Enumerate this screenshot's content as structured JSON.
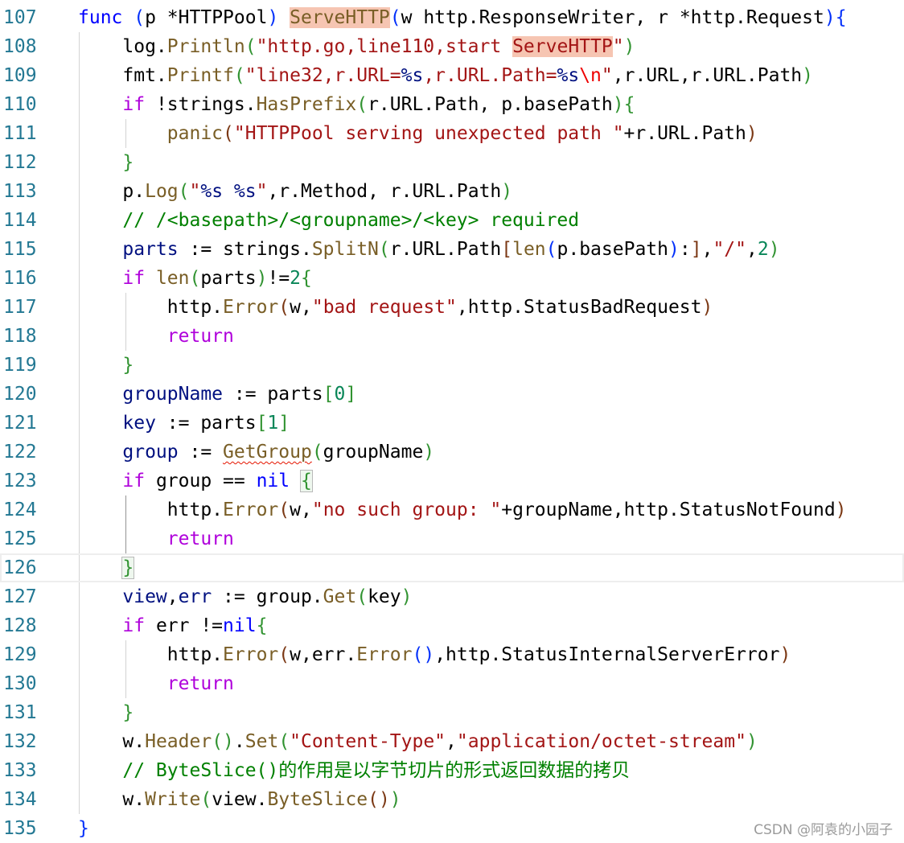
{
  "editor": {
    "current_line": "126",
    "lines": [
      {
        "number": "107",
        "indent": 0,
        "tokens": [
          {
            "t": "func",
            "c": "kw"
          },
          {
            "t": " "
          },
          {
            "t": "(",
            "c": "b1"
          },
          {
            "t": "p *HTTPPool"
          },
          {
            "t": ")",
            "c": "b1"
          },
          {
            "t": " "
          },
          {
            "t": "ServeHTTP",
            "c": "fn",
            "hl": true
          },
          {
            "t": "(",
            "c": "b1"
          },
          {
            "t": "w http.ResponseWriter, r *http.Request"
          },
          {
            "t": ")",
            "c": "b1"
          },
          {
            "t": "{",
            "c": "b1"
          }
        ]
      },
      {
        "number": "108",
        "indent": 1,
        "tokens": [
          {
            "t": "log."
          },
          {
            "t": "Println",
            "c": "fn"
          },
          {
            "t": "(",
            "c": "b2"
          },
          {
            "t": "\"http.go,line110,start ",
            "c": "str"
          },
          {
            "t": "ServeHTTP",
            "c": "str",
            "hl": true
          },
          {
            "t": "\"",
            "c": "str"
          },
          {
            "t": ")",
            "c": "b2"
          }
        ]
      },
      {
        "number": "109",
        "indent": 1,
        "tokens": [
          {
            "t": "fmt."
          },
          {
            "t": "Printf",
            "c": "fn"
          },
          {
            "t": "(",
            "c": "b2"
          },
          {
            "t": "\"line32,r.URL=",
            "c": "str"
          },
          {
            "t": "%s",
            "c": "var"
          },
          {
            "t": ",r.URL.Path=",
            "c": "str"
          },
          {
            "t": "%s",
            "c": "var"
          },
          {
            "t": "\\n",
            "c": "esc"
          },
          {
            "t": "\"",
            "c": "str"
          },
          {
            "t": ",r.URL,r.URL.Path"
          },
          {
            "t": ")",
            "c": "b2"
          }
        ]
      },
      {
        "number": "110",
        "indent": 1,
        "tokens": [
          {
            "t": "if",
            "c": "ctrl"
          },
          {
            "t": " !strings."
          },
          {
            "t": "HasPrefix",
            "c": "fn"
          },
          {
            "t": "(",
            "c": "b2"
          },
          {
            "t": "r.URL.Path, p.basePath"
          },
          {
            "t": ")",
            "c": "b2"
          },
          {
            "t": "{",
            "c": "b2"
          }
        ]
      },
      {
        "number": "111",
        "indent": 2,
        "tokens": [
          {
            "t": "panic",
            "c": "fn"
          },
          {
            "t": "(",
            "c": "b3"
          },
          {
            "t": "\"HTTPPool serving unexpected path \"",
            "c": "str"
          },
          {
            "t": "+r.URL.Path"
          },
          {
            "t": ")",
            "c": "b3"
          }
        ]
      },
      {
        "number": "112",
        "indent": 1,
        "tokens": [
          {
            "t": "}",
            "c": "b2"
          }
        ]
      },
      {
        "number": "113",
        "indent": 1,
        "tokens": [
          {
            "t": "p."
          },
          {
            "t": "Log",
            "c": "fn"
          },
          {
            "t": "(",
            "c": "b2"
          },
          {
            "t": "\"",
            "c": "str"
          },
          {
            "t": "%s",
            "c": "var"
          },
          {
            "t": " ",
            "c": "str"
          },
          {
            "t": "%s",
            "c": "var"
          },
          {
            "t": "\"",
            "c": "str"
          },
          {
            "t": ",r.Method, r.URL.Path"
          },
          {
            "t": ")",
            "c": "b2"
          }
        ]
      },
      {
        "number": "114",
        "indent": 1,
        "tokens": [
          {
            "t": "// /<basepath>/<groupname>/<key> required",
            "c": "com"
          }
        ]
      },
      {
        "number": "115",
        "indent": 1,
        "tokens": [
          {
            "t": "parts",
            "c": "var"
          },
          {
            "t": " := strings."
          },
          {
            "t": "SplitN",
            "c": "fn"
          },
          {
            "t": "(",
            "c": "b2"
          },
          {
            "t": "r.URL.Path"
          },
          {
            "t": "[",
            "c": "b3"
          },
          {
            "t": "len",
            "c": "fn"
          },
          {
            "t": "(",
            "c": "b1"
          },
          {
            "t": "p.basePath"
          },
          {
            "t": ")",
            "c": "b1"
          },
          {
            "t": ":"
          },
          {
            "t": "]",
            "c": "b3"
          },
          {
            "t": ","
          },
          {
            "t": "\"/\"",
            "c": "str"
          },
          {
            "t": ","
          },
          {
            "t": "2",
            "c": "num"
          },
          {
            "t": ")",
            "c": "b2"
          }
        ]
      },
      {
        "number": "116",
        "indent": 1,
        "tokens": [
          {
            "t": "if",
            "c": "ctrl"
          },
          {
            "t": " "
          },
          {
            "t": "len",
            "c": "fn"
          },
          {
            "t": "(",
            "c": "b2"
          },
          {
            "t": "parts"
          },
          {
            "t": ")",
            "c": "b2"
          },
          {
            "t": "!="
          },
          {
            "t": "2",
            "c": "num"
          },
          {
            "t": "{",
            "c": "b2"
          }
        ]
      },
      {
        "number": "117",
        "indent": 2,
        "tokens": [
          {
            "t": "http."
          },
          {
            "t": "Error",
            "c": "fn"
          },
          {
            "t": "(",
            "c": "b3"
          },
          {
            "t": "w,"
          },
          {
            "t": "\"bad request\"",
            "c": "str"
          },
          {
            "t": ",http.StatusBadRequest"
          },
          {
            "t": ")",
            "c": "b3"
          }
        ]
      },
      {
        "number": "118",
        "indent": 2,
        "tokens": [
          {
            "t": "return",
            "c": "ctrl"
          }
        ]
      },
      {
        "number": "119",
        "indent": 1,
        "tokens": [
          {
            "t": "}",
            "c": "b2"
          }
        ]
      },
      {
        "number": "120",
        "indent": 1,
        "tokens": [
          {
            "t": "groupName",
            "c": "var"
          },
          {
            "t": " := parts"
          },
          {
            "t": "[",
            "c": "b2"
          },
          {
            "t": "0",
            "c": "num"
          },
          {
            "t": "]",
            "c": "b2"
          }
        ]
      },
      {
        "number": "121",
        "indent": 1,
        "tokens": [
          {
            "t": "key",
            "c": "var"
          },
          {
            "t": " := parts"
          },
          {
            "t": "[",
            "c": "b2"
          },
          {
            "t": "1",
            "c": "num"
          },
          {
            "t": "]",
            "c": "b2"
          }
        ]
      },
      {
        "number": "122",
        "indent": 1,
        "tokens": [
          {
            "t": "group",
            "c": "var"
          },
          {
            "t": " := "
          },
          {
            "t": "GetGroup",
            "c": "fn",
            "squig": true
          },
          {
            "t": "(",
            "c": "b2"
          },
          {
            "t": "groupName"
          },
          {
            "t": ")",
            "c": "b2"
          }
        ]
      },
      {
        "number": "123",
        "indent": 1,
        "tokens": [
          {
            "t": "if",
            "c": "ctrl"
          },
          {
            "t": " group == "
          },
          {
            "t": "nil",
            "c": "kw"
          },
          {
            "t": " "
          },
          {
            "t": "{",
            "c": "b2",
            "match": true
          }
        ]
      },
      {
        "number": "124",
        "indent": 2,
        "active_guide": true,
        "tokens": [
          {
            "t": "http."
          },
          {
            "t": "Error",
            "c": "fn"
          },
          {
            "t": "(",
            "c": "b3"
          },
          {
            "t": "w,"
          },
          {
            "t": "\"no such group: \"",
            "c": "str"
          },
          {
            "t": "+groupName,http.StatusNotFound"
          },
          {
            "t": ")",
            "c": "b3"
          }
        ]
      },
      {
        "number": "125",
        "indent": 2,
        "active_guide": true,
        "tokens": [
          {
            "t": "return",
            "c": "ctrl"
          }
        ]
      },
      {
        "number": "126",
        "indent": 1,
        "tokens": [
          {
            "t": "}",
            "c": "b2",
            "match": true
          }
        ]
      },
      {
        "number": "127",
        "indent": 1,
        "tokens": [
          {
            "t": "view",
            "c": "var"
          },
          {
            "t": ","
          },
          {
            "t": "err",
            "c": "var"
          },
          {
            "t": " := group."
          },
          {
            "t": "Get",
            "c": "fn"
          },
          {
            "t": "(",
            "c": "b2"
          },
          {
            "t": "key"
          },
          {
            "t": ")",
            "c": "b2"
          }
        ]
      },
      {
        "number": "128",
        "indent": 1,
        "tokens": [
          {
            "t": "if",
            "c": "ctrl"
          },
          {
            "t": " err !="
          },
          {
            "t": "nil",
            "c": "kw"
          },
          {
            "t": "{",
            "c": "b2"
          }
        ]
      },
      {
        "number": "129",
        "indent": 2,
        "tokens": [
          {
            "t": "http."
          },
          {
            "t": "Error",
            "c": "fn"
          },
          {
            "t": "(",
            "c": "b3"
          },
          {
            "t": "w,err."
          },
          {
            "t": "Error",
            "c": "fn"
          },
          {
            "t": "(",
            "c": "b1"
          },
          {
            "t": ")",
            "c": "b1"
          },
          {
            "t": ",http.StatusInternalServerError"
          },
          {
            "t": ")",
            "c": "b3"
          }
        ]
      },
      {
        "number": "130",
        "indent": 2,
        "tokens": [
          {
            "t": "return",
            "c": "ctrl"
          }
        ]
      },
      {
        "number": "131",
        "indent": 1,
        "tokens": [
          {
            "t": "}",
            "c": "b2"
          }
        ]
      },
      {
        "number": "132",
        "indent": 1,
        "tokens": [
          {
            "t": "w."
          },
          {
            "t": "Header",
            "c": "fn"
          },
          {
            "t": "(",
            "c": "b2"
          },
          {
            "t": ")",
            "c": "b2"
          },
          {
            "t": "."
          },
          {
            "t": "Set",
            "c": "fn"
          },
          {
            "t": "(",
            "c": "b2"
          },
          {
            "t": "\"Content-Type\"",
            "c": "str"
          },
          {
            "t": ","
          },
          {
            "t": "\"application/octet-stream\"",
            "c": "str"
          },
          {
            "t": ")",
            "c": "b2"
          }
        ]
      },
      {
        "number": "133",
        "indent": 1,
        "tokens": [
          {
            "t": "// ByteSlice()的作用是以字节切片的形式返回数据的拷贝",
            "c": "com"
          }
        ]
      },
      {
        "number": "134",
        "indent": 1,
        "tokens": [
          {
            "t": "w."
          },
          {
            "t": "Write",
            "c": "fn"
          },
          {
            "t": "(",
            "c": "b2"
          },
          {
            "t": "view."
          },
          {
            "t": "ByteSlice",
            "c": "fn"
          },
          {
            "t": "(",
            "c": "b3"
          },
          {
            "t": ")",
            "c": "b3"
          },
          {
            "t": ")",
            "c": "b2"
          }
        ]
      },
      {
        "number": "135",
        "indent": 0,
        "tokens": [
          {
            "t": "}",
            "c": "b1"
          }
        ]
      }
    ]
  },
  "watermark": "CSDN @阿袁的小园子",
  "colors": {
    "background": "#ffffff",
    "line_number": "#237893",
    "keyword": "#0000ff",
    "control": "#af00db",
    "function": "#795e26",
    "string": "#a31515",
    "variable": "#001080",
    "number": "#098658",
    "comment": "#008000",
    "highlight": "#f6c5b2"
  }
}
